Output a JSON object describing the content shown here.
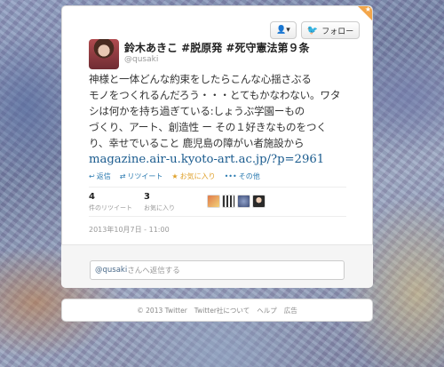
{
  "header": {
    "follow_label": "フォロー",
    "person_menu_icon": "person-icon"
  },
  "tweet": {
    "author_name": "鈴木あきこ #脱原発 #死守憲法第９条",
    "author_handle": "@qusaki",
    "text_lines": [
      "神様と一体どんな約束をしたらこんな心揺さぶる",
      "モノをつくれるんだろう・・・とてもかなわない。ワタ",
      "シは何かを持ち過ぎている:しょうぶ学園ーもの",
      "づくり、アート、創造性 ー その１好きなものをつく",
      "り、幸せでいること 鹿児島の障がい者施設から"
    ],
    "link": "magazine.air-u.kyoto-art.ac.jp/?p=2961",
    "actions": {
      "reply": "返信",
      "retweet": "リツイート",
      "favorite": "お気に入り",
      "more": "その他"
    },
    "stats": {
      "retweets_count": "4",
      "retweets_label": "件のリツイート",
      "favorites_count": "3",
      "favorites_label": "お気に入り"
    },
    "timestamp": "2013年10月7日 - 11:00"
  },
  "reply": {
    "mention": "@qusaki",
    "placeholder": "さんへ返信する"
  },
  "footer": {
    "copyright": "© 2013 Twitter",
    "about": "Twitter社について",
    "help": "ヘルプ",
    "ads": "広告"
  },
  "colors": {
    "link": "#1a5b8e",
    "twitter_blue": "#2aa3ef",
    "favorite_gold": "#e0a12b",
    "corner_badge": "#f3a64a"
  }
}
